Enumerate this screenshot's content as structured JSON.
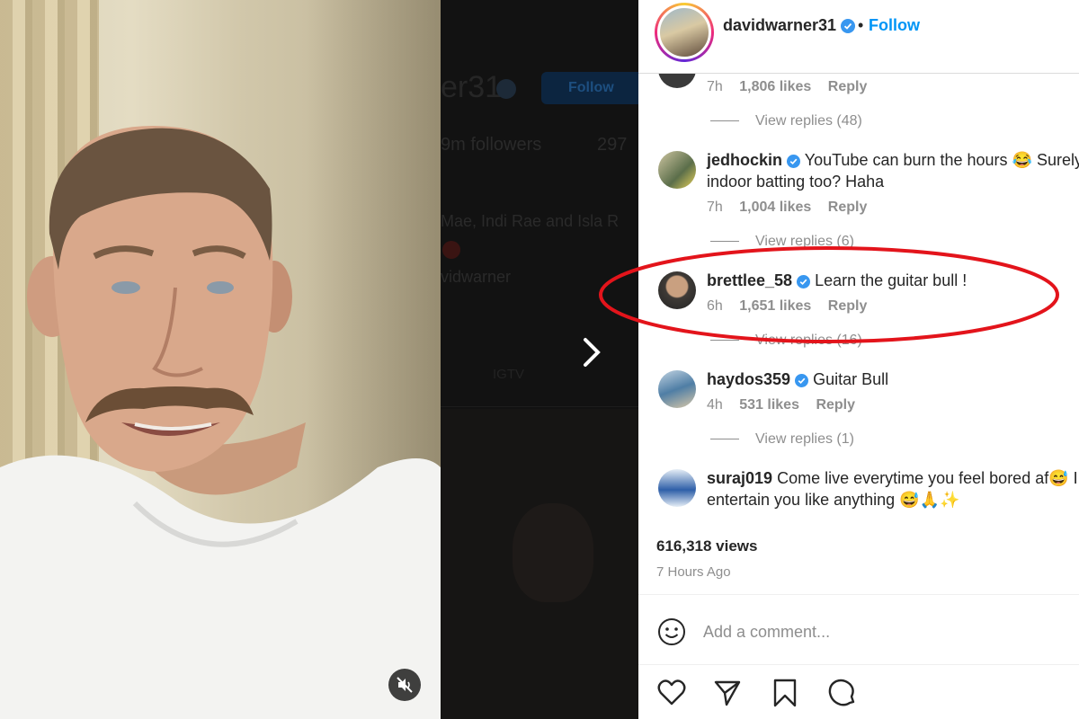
{
  "profile_backdrop": {
    "username_fragment": "er31",
    "follow_label": "Follow",
    "followers_fragment": "9m followers",
    "following_fragment": "297",
    "bio_fragment": "Mae, Indi Rae and Isla R",
    "handle_fragment": "vidwarner",
    "igtv_label": "IGTV"
  },
  "header": {
    "username": "davidwarner31",
    "separator": "•",
    "follow_label": "Follow"
  },
  "comments": [
    {
      "username": "",
      "text": "",
      "time": "7h",
      "likes": "1,806 likes",
      "reply": "Reply",
      "view_replies": "View replies (48)"
    },
    {
      "username": "jedhockin",
      "text_line1": "YouTube can burn the hours 😂 Surely",
      "text_line2": "indoor batting too? Haha",
      "time": "7h",
      "likes": "1,004 likes",
      "reply": "Reply",
      "view_replies": "View replies (6)"
    },
    {
      "username": "brettlee_58",
      "text_line1": "Learn the guitar bull !",
      "time": "6h",
      "likes": "1,651 likes",
      "reply": "Reply",
      "view_replies": "View replies (16)"
    },
    {
      "username": "haydos359",
      "text_line1": "Guitar Bull",
      "time": "4h",
      "likes": "531 likes",
      "reply": "Reply",
      "view_replies": "View replies (1)"
    },
    {
      "username": "suraj019",
      "text_line1": "Come live everytime you feel bored af😅 I",
      "text_line2": "entertain you like anything 😅🙏✨"
    }
  ],
  "stats": {
    "views": "616,318 views",
    "time_ago": "7 Hours Ago"
  },
  "add_comment": {
    "placeholder": "Add a comment..."
  },
  "colors": {
    "accent": "#0095f6",
    "verified": "#3897f0",
    "highlight": "#e3141b",
    "muted": "#8e8e8e",
    "text": "#262626"
  },
  "icons": [
    "mute-icon",
    "chevron-right-icon",
    "verified-icon",
    "smiley-icon",
    "heart-icon",
    "share-icon",
    "bookmark-icon",
    "comment-icon"
  ]
}
